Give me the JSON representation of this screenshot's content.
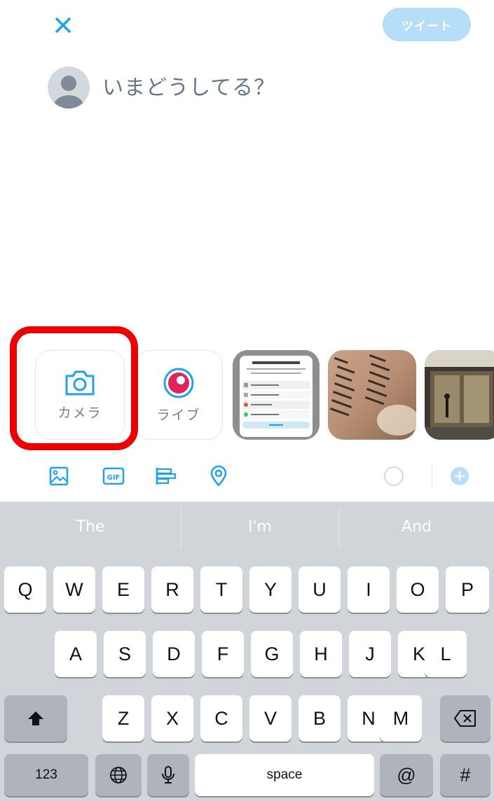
{
  "header": {
    "tweet_label": "ツイート"
  },
  "compose": {
    "placeholder": "いまどうしてる？"
  },
  "media_strip": {
    "camera_label": "カメラ",
    "live_label": "ライブ"
  },
  "suggestions": [
    "The",
    "I'm",
    "And"
  ],
  "keyboard": {
    "row1": [
      "Q",
      "W",
      "E",
      "R",
      "T",
      "Y",
      "U",
      "I",
      "O",
      "P"
    ],
    "row2": [
      "A",
      "S",
      "D",
      "F",
      "G",
      "H",
      "J",
      "K",
      "L"
    ],
    "row3": [
      "Z",
      "X",
      "C",
      "V",
      "B",
      "N",
      "M"
    ],
    "numbers_label": "123",
    "space_label": "space",
    "at_label": "@",
    "hash_label": "#"
  },
  "colors": {
    "accent": "#1da1f2",
    "tweet_button_disabled": "#b7def8",
    "highlight_frame": "#ee0000"
  }
}
